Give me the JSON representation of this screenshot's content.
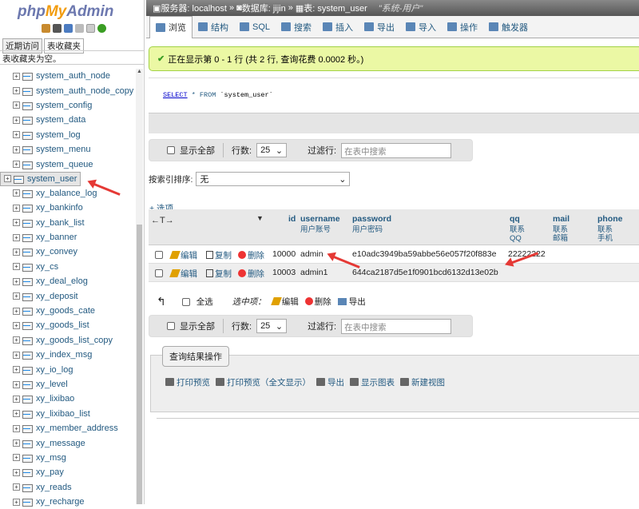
{
  "logo": {
    "php": "php",
    "my": "My",
    "admin": "Admin"
  },
  "left_tabs": [
    "近期访问",
    "表收藏夹"
  ],
  "favorites_empty": "表收藏夹为空。",
  "tree_items": [
    "system_auth_node",
    "system_auth_node_copy",
    "system_config",
    "system_data",
    "system_log",
    "system_menu",
    "system_queue",
    "system_user",
    "xy_balance_log",
    "xy_bankinfo",
    "xy_bank_list",
    "xy_banner",
    "xy_convey",
    "xy_cs",
    "xy_deal_elog",
    "xy_deposit",
    "xy_goods_cate",
    "xy_goods_list",
    "xy_goods_list_copy",
    "xy_index_msg",
    "xy_io_log",
    "xy_level",
    "xy_lixibao",
    "xy_lixibao_list",
    "xy_member_address",
    "xy_message",
    "xy_msg",
    "xy_pay",
    "xy_reads",
    "xy_recharge"
  ],
  "selected_table": "system_user",
  "breadcrumb": {
    "server": "服务器: localhost",
    "database": "数据库: jijin",
    "table": "表: system_user",
    "comment": "\"系统-用户\""
  },
  "tabs": [
    "浏览",
    "结构",
    "SQL",
    "搜索",
    "插入",
    "导出",
    "导入",
    "操作",
    "触发器"
  ],
  "success_msg": "正在显示第 0 - 1 行 (共 2 行, 查询花费 0.0002 秒。)",
  "sql": {
    "select": "SELECT",
    "rest": " * FROM ",
    "table": "`system_user`"
  },
  "nav": {
    "show_all": "显示全部",
    "rows_label": "行数:",
    "rows_value": "25",
    "filter_label": "过滤行:",
    "filter_placeholder": "在表中搜索"
  },
  "sort": {
    "label": "按索引排序:",
    "value": "无"
  },
  "options_link": "+ 选项",
  "columns": [
    {
      "name": "id",
      "comment": ""
    },
    {
      "name": "username",
      "comment": "用户账号"
    },
    {
      "name": "password",
      "comment": "用户密码"
    },
    {
      "name": "qq",
      "comment": "联系QQ"
    },
    {
      "name": "mail",
      "comment": "联系邮箱"
    },
    {
      "name": "phone",
      "comment": "联系手机"
    }
  ],
  "col_tools": "←T→",
  "actions": {
    "edit": "编辑",
    "copy": "复制",
    "delete": "删除"
  },
  "rows": [
    {
      "id": "10000",
      "username": "admin",
      "password": "e10adc3949ba59abbe56e057f20f883e",
      "qq": "22222222"
    },
    {
      "id": "10003",
      "username": "admin1",
      "password": "644ca2187d5e1f0901bcd6132d13e02b",
      "qq": ""
    }
  ],
  "bulk": {
    "check_all": "全选",
    "selected_label": "选中项：",
    "edit": "编辑",
    "delete": "删除",
    "export": "导出"
  },
  "query_ops": {
    "legend": "查询结果操作",
    "links": [
      "打印预览",
      "打印预览（全文显示）",
      "导出",
      "显示图表",
      "新建视图"
    ]
  },
  "colors": {
    "link": "#235a81",
    "success_bg": "#ebf8a4",
    "annotation": "#e53935"
  }
}
